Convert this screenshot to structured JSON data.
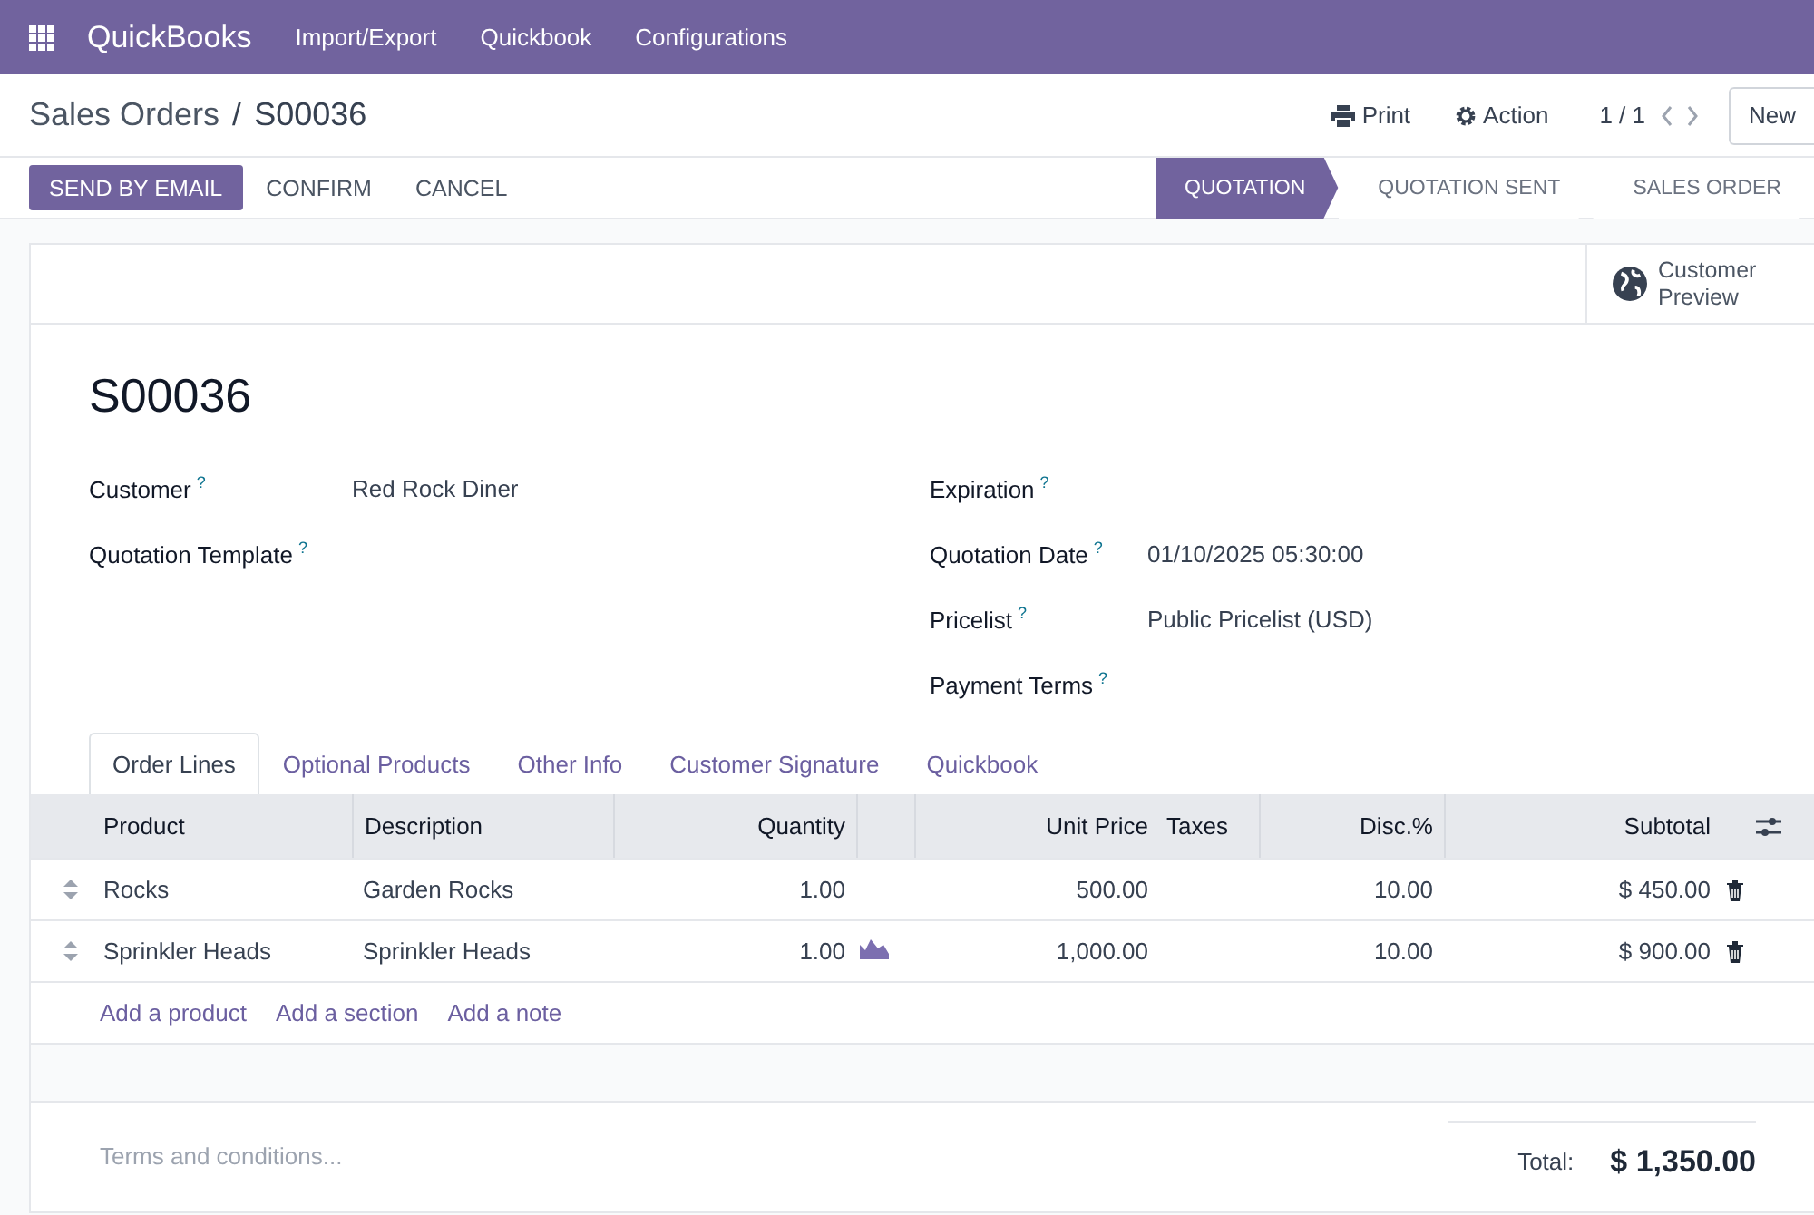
{
  "navbar": {
    "app": "QuickBooks",
    "menus": [
      "Import/Export",
      "Quickbook",
      "Configurations"
    ]
  },
  "breadcrumb": {
    "parent": "Sales Orders",
    "separator": "/",
    "current": "S00036"
  },
  "control_panel": {
    "print": "Print",
    "action": "Action",
    "pager": "1 / 1",
    "new_button": "New"
  },
  "action_buttons": [
    {
      "label": "SEND BY EMAIL",
      "primary": true
    },
    {
      "label": "CONFIRM",
      "primary": false
    },
    {
      "label": "CANCEL",
      "primary": false
    }
  ],
  "statusbar": [
    {
      "label": "QUOTATION",
      "selected": true
    },
    {
      "label": "QUOTATION SENT",
      "selected": false
    },
    {
      "label": "SALES ORDER",
      "selected": false
    }
  ],
  "smart_button": {
    "label": "Customer Preview"
  },
  "form": {
    "title": "S00036",
    "left_fields": [
      {
        "label": "Customer",
        "value": "Red Rock Diner"
      },
      {
        "label": "Quotation Template"
      }
    ],
    "right_fields": [
      {
        "label": "Expiration"
      },
      {
        "label": "Quotation Date",
        "value": "01/10/2025 05:30:00"
      },
      {
        "label": "Pricelist",
        "value": "Public Pricelist (USD)"
      },
      {
        "label": "Payment Terms"
      }
    ],
    "help_mark": "?"
  },
  "tabs": [
    {
      "label": "Order Lines",
      "selected": true
    },
    {
      "label": "Optional Products",
      "selected": false
    },
    {
      "label": "Other Info",
      "selected": false
    },
    {
      "label": "Customer Signature",
      "selected": false
    },
    {
      "label": "Quickbook",
      "selected": false
    }
  ],
  "table": {
    "columns": [
      "Product",
      "Description",
      "Quantity",
      "Unit Price",
      "Taxes",
      "Disc.%",
      "Subtotal"
    ],
    "rows": [
      {
        "product": "Rocks",
        "description": "Garden Rocks",
        "quantity": "1.00",
        "forecast_icon": false,
        "unit_price": "500.00",
        "taxes": "",
        "discount": "10.00",
        "subtotal": "$ 450.00"
      },
      {
        "product": "Sprinkler Heads",
        "description": "Sprinkler Heads",
        "quantity": "1.00",
        "forecast_icon": true,
        "unit_price": "1,000.00",
        "discount": "10.00",
        "subtotal": "$ 900.00"
      }
    ],
    "add_links": [
      "Add a product",
      "Add a section",
      "Add a note"
    ]
  },
  "terms": {
    "placeholder": "Terms and conditions..."
  },
  "total": {
    "label": "Total:",
    "value": "$ 1,350.00"
  }
}
